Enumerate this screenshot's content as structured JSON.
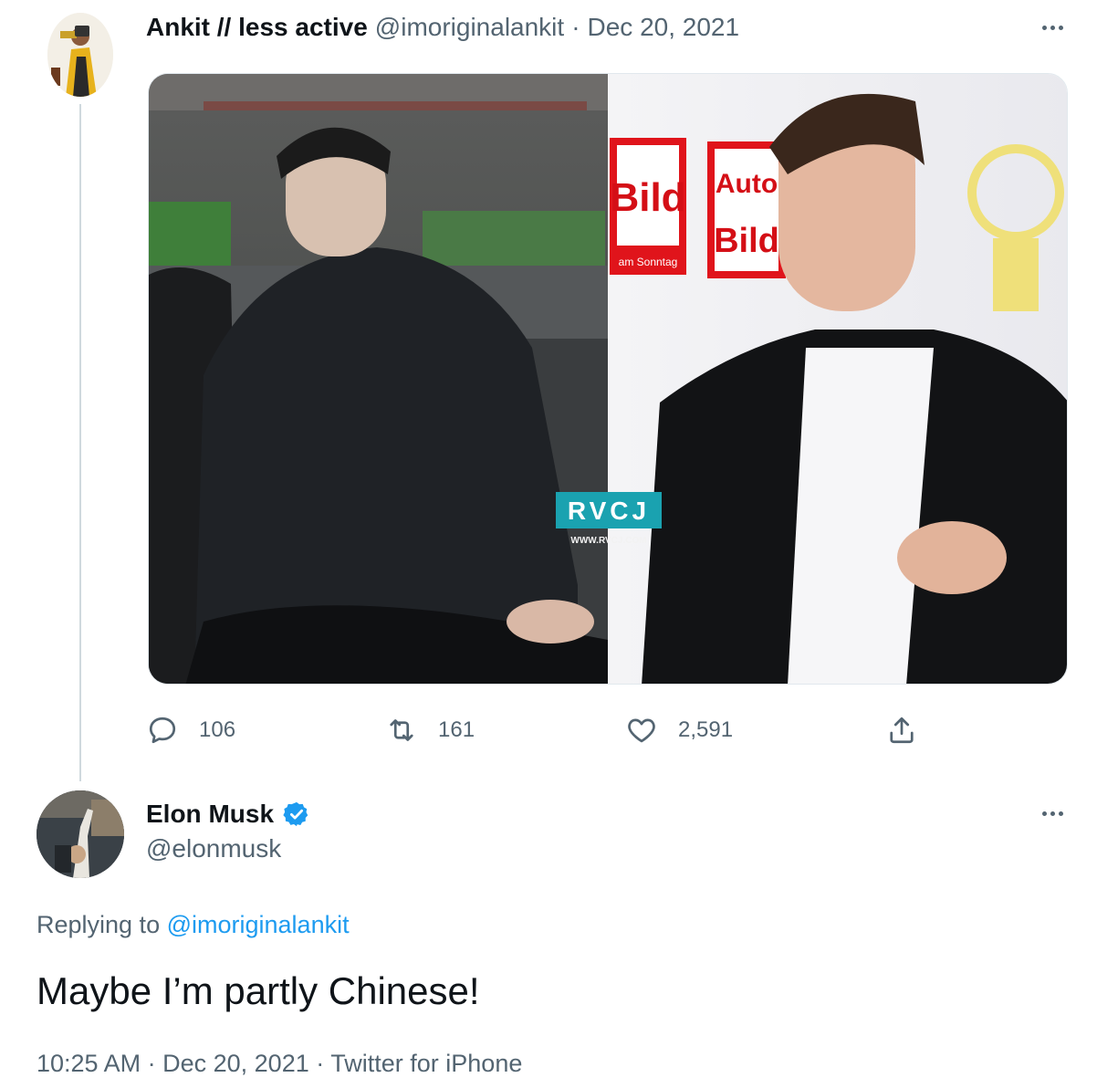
{
  "parent_tweet": {
    "display_name": "Ankit // less active",
    "handle": "@imoriginalankit",
    "separator": "·",
    "date": "Dec 20, 2021",
    "media": {
      "watermark_brand": "RVCJ",
      "watermark_url": "WWW.RVCJ.COM",
      "backdrop_text_1": "Bild",
      "backdrop_text_2": "am Sonntag",
      "backdrop_text_3": "Auto",
      "backdrop_text_4": "Bild"
    },
    "stats": {
      "replies": "106",
      "retweets": "161",
      "likes": "2,591"
    },
    "icons": {
      "reply": "reply-icon",
      "retweet": "retweet-icon",
      "like": "heart-icon",
      "share": "share-icon",
      "more": "more-icon"
    }
  },
  "reply_tweet": {
    "display_name": "Elon Musk",
    "handle": "@elonmusk",
    "verified": true,
    "replying_prefix": "Replying to",
    "replying_handle": "@imoriginalankit",
    "text": "Maybe I’m partly Chinese!",
    "time": "10:25 AM",
    "separator": "·",
    "date": "Dec 20, 2021",
    "source": "Twitter for iPhone"
  },
  "colors": {
    "accent": "#1d9bf0",
    "secondary_text": "#536471",
    "primary_text": "#0f1419",
    "divider": "#cfd9de"
  }
}
